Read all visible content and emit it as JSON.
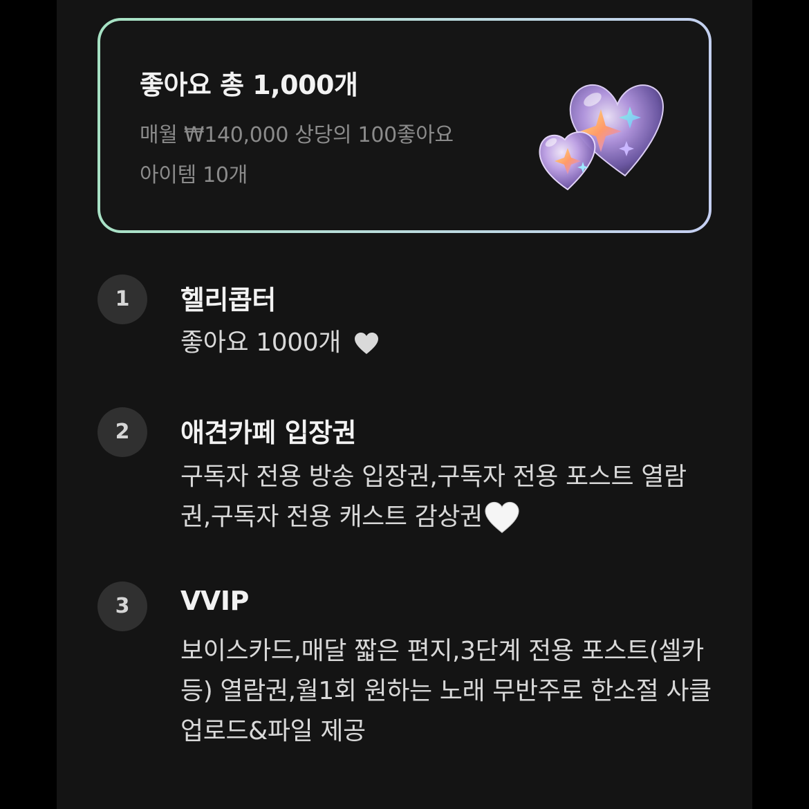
{
  "card": {
    "title": "좋아요 총 1,000개",
    "subtitle_line1": "매월 ₩140,000 상당의 100좋아요",
    "subtitle_line2": "아이템 10개",
    "image": "sparkle-hearts-icon",
    "border_gradient": [
      "#a6e2c3",
      "#c5cff2"
    ]
  },
  "tiers": [
    {
      "number": "1",
      "title": "헬리콥터",
      "description": "좋아요 1000개",
      "trailing_icon": "white-heart-icon"
    },
    {
      "number": "2",
      "title": "애견카페 입장권",
      "description": "구독자 전용 방송 입장권,구독자 전용 포스트 열람권,구독자 전용 캐스트 감상권",
      "trailing_icon": "white-heart-icon"
    },
    {
      "number": "3",
      "title": "VVIP",
      "description": "보이스카드,매달 짧은 편지,3단계 전용 포스트(셀카 등) 열람권,월1회 원하는 노래 무반주로 한소절 사클 업로드&파일 제공"
    }
  ],
  "colors": {
    "background": "#141414",
    "outer": "#000000",
    "number_badge": "#303030",
    "title_text": "#f2f2f2",
    "muted_text": "#8b8b8b",
    "body_text": "#d9d9d9"
  }
}
